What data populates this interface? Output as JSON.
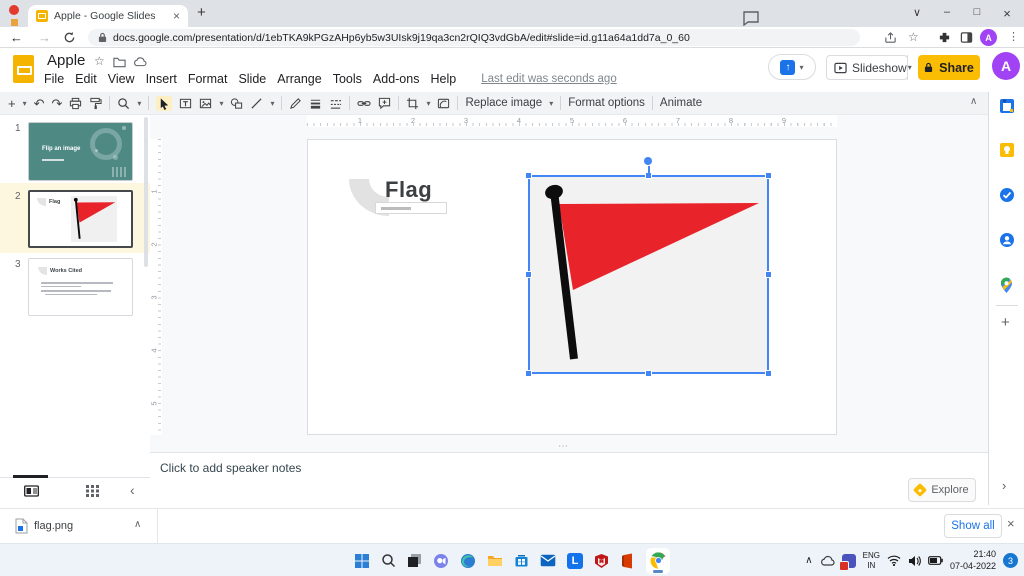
{
  "browser": {
    "tab_title": "Apple - Google Slides",
    "url": "docs.google.com/presentation/d/1ebTKA9kPGzAHp6yb5w3UIsk9j19qa3cn2rQIQ3vdGbA/edit#slide=id.g11a64a1dd7a_0_60"
  },
  "header": {
    "doc_title": "Apple",
    "menus": [
      "File",
      "Edit",
      "View",
      "Insert",
      "Format",
      "Slide",
      "Arrange",
      "Tools",
      "Add-ons",
      "Help"
    ],
    "last_edit": "Last edit was seconds ago",
    "slideshow_label": "Slideshow",
    "share_label": "Share",
    "avatar_letter": "A"
  },
  "toolbar": {
    "replace_image_label": "Replace image",
    "format_options_label": "Format options",
    "animate_label": "Animate"
  },
  "filmstrip": {
    "slide1": {
      "number": "1",
      "title": "Flip an image"
    },
    "slide2": {
      "number": "2",
      "title": "Flag"
    },
    "slide3": {
      "number": "3",
      "title": "Works Cited"
    }
  },
  "canvas": {
    "slide_title": "Flag",
    "h_ruler": [
      "1",
      "2",
      "3",
      "4",
      "5",
      "6",
      "7",
      "8",
      "9"
    ],
    "v_ruler": [
      "1",
      "2",
      "3",
      "4",
      "5"
    ]
  },
  "notes": {
    "placeholder": "Click to add speaker notes"
  },
  "explore_label": "Explore",
  "downloads": {
    "filename": "flag.png",
    "show_all_label": "Show all"
  },
  "tray": {
    "lang1": "ENG",
    "lang2": "IN",
    "time": "21:40",
    "date": "07-04-2022",
    "badge": "3"
  },
  "colors": {
    "accent_blue": "#4285f4",
    "flag_red": "#e8232a",
    "share_yellow": "#fbbc04",
    "slide_teal": "#4e8984"
  },
  "glyphs": {
    "plus": "+",
    "caret": "▾",
    "undo": "↶",
    "redo": "↷",
    "back": "←",
    "forward": "→",
    "star": "☆",
    "kebab": "⋮",
    "close": "×",
    "minimize": "–",
    "maximize": "□",
    "chevron_down": "∨",
    "chevron_up": "∧",
    "panel_collapse": "‹",
    "panel_expand": "›",
    "notes_handle": "⋯"
  }
}
